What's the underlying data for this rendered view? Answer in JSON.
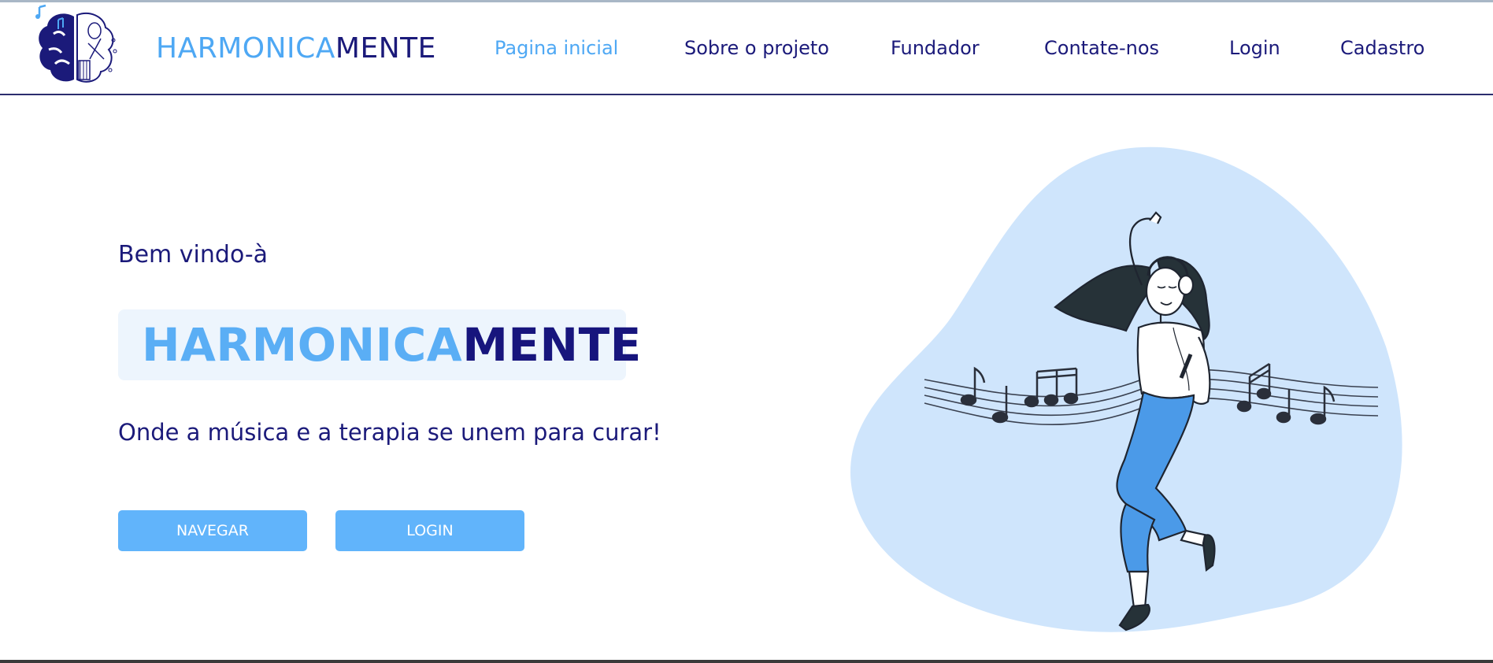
{
  "header": {
    "brand_light": "HARMONICA",
    "brand_dark": "MENTE",
    "logo_icon": "brain-music-logo"
  },
  "nav": {
    "items": [
      {
        "label": "Pagina inicial",
        "active": true
      },
      {
        "label": "Sobre o projeto",
        "active": false
      },
      {
        "label": "Fundador",
        "active": false
      },
      {
        "label": "Contate-nos",
        "active": false
      },
      {
        "label": "Login",
        "active": false
      },
      {
        "label": "Cadastro",
        "active": false
      }
    ]
  },
  "hero": {
    "welcome": "Bem vindo-à",
    "title_light": "HARMONICA",
    "title_dark": "MENTE",
    "tagline": "Onde a música e a terapia se unem para curar!",
    "buttons": {
      "navegar": "NAVEGAR",
      "login": "LOGIN"
    },
    "illustration": "woman-dancing-with-headphones-music-notes"
  },
  "colors": {
    "accent": "#61b4fb",
    "brand_light": "#4ea8f4",
    "brand_dark": "#1b1a7a",
    "blob": "#cfe5fc",
    "badge_bg": "#edf5fd"
  }
}
